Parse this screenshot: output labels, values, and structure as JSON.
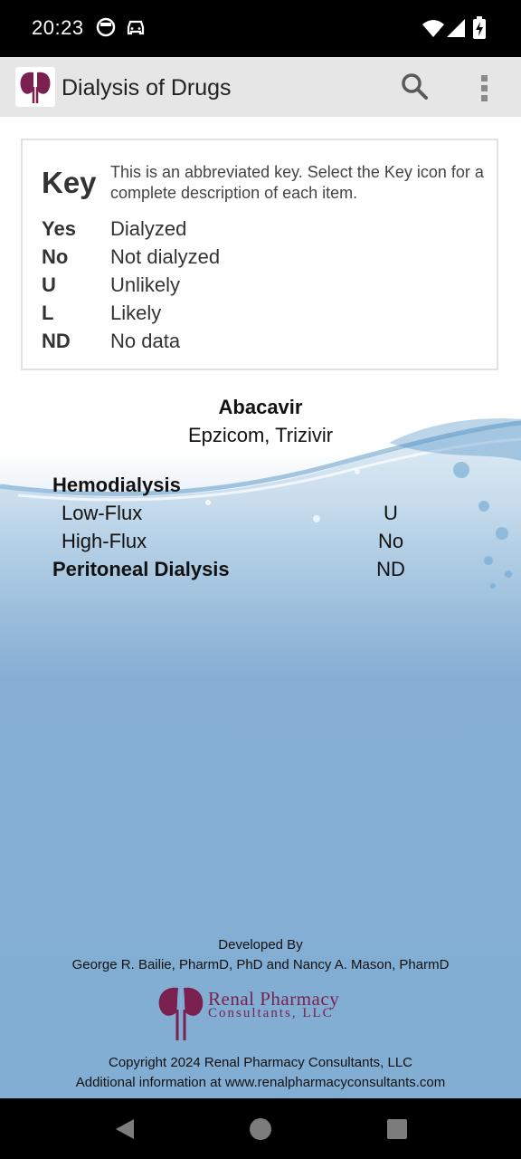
{
  "status_bar": {
    "time": "20:23",
    "icons": [
      "notification-face-icon",
      "car-icon",
      "wifi-icon",
      "signal-icon",
      "battery-charging-icon"
    ]
  },
  "app_bar": {
    "title": "Dialysis of Drugs",
    "logo_icon": "kidney-logo-icon",
    "actions": [
      "search-icon",
      "overflow-menu-icon"
    ]
  },
  "key": {
    "title": "Key",
    "description": "This is an abbreviated key. Select the Key icon for a complete description of each item.",
    "items": [
      {
        "abbr": "Yes",
        "meaning": "Dialyzed"
      },
      {
        "abbr": "No",
        "meaning": "Not dialyzed"
      },
      {
        "abbr": "U",
        "meaning": "Unlikely"
      },
      {
        "abbr": "L",
        "meaning": "Likely"
      },
      {
        "abbr": "ND",
        "meaning": "No data"
      }
    ]
  },
  "drug": {
    "name": "Abacavir",
    "brands": "Epzicom, Trizivir",
    "hemodialysis_label": "Hemodialysis",
    "rows": [
      {
        "label": "Low-Flux",
        "value": "U"
      },
      {
        "label": "High-Flux",
        "value": "No"
      }
    ],
    "peritoneal_label": "Peritoneal Dialysis",
    "peritoneal_value": "ND"
  },
  "footer": {
    "developed_by": "Developed By",
    "developers": "George R. Bailie, PharmD, PhD and Nancy A. Mason, PharmD",
    "company_line1": "Renal Pharmacy",
    "company_line2": "Consultants, LLC",
    "copyright": "Copyright 2024 Renal Pharmacy Consultants, LLC",
    "additional_info": "Additional information at www.renalpharmacyconsultants.com"
  },
  "nav_bar": {
    "buttons": [
      "back-icon",
      "home-icon",
      "recents-icon"
    ]
  },
  "colors": {
    "brand": "#7a2150",
    "app_bar": "#e6e6e6",
    "water_blue": "#82aed3"
  }
}
